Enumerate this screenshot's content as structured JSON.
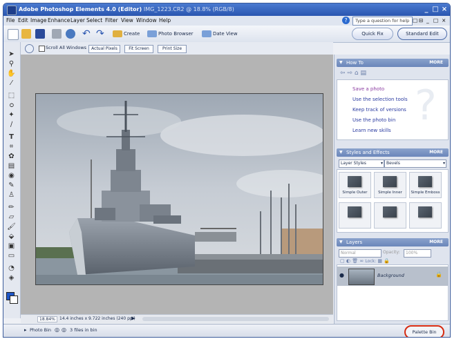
{
  "window": {
    "title": "Adobe Photoshop Elements 4.0 (Editor)",
    "document": "IMG_1223.CR2 @ 18.8% (RGB/8)",
    "controls": [
      "_",
      "□",
      "×"
    ]
  },
  "menu": {
    "items": [
      "File",
      "Edit",
      "Image",
      "Enhance",
      "Layer",
      "Select",
      "Filter",
      "View",
      "Window",
      "Help"
    ],
    "help_placeholder": "Type a question for help",
    "doc_controls": [
      "□",
      "⊟",
      "_",
      "□",
      "×"
    ]
  },
  "shortcuts": {
    "create": "Create",
    "photo_browser": "Photo Browser",
    "date_view": "Date View",
    "quick_fix": "Quick Fix",
    "standard_edit": "Standard Edit"
  },
  "options_bar": {
    "scroll_all": "Scroll All Windows",
    "actual_pixels": "Actual Pixels",
    "fit_screen": "Fit Screen",
    "print_size": "Print Size"
  },
  "status": {
    "zoom": "18.84%",
    "doc_size": "14.4 inches x 9.722 inches (240 ppi)"
  },
  "photo_bin": {
    "label": "Photo Bin",
    "count": "3 files in bin",
    "dock_label": "Palette Bin"
  },
  "how_to": {
    "title": "How To",
    "more": "MORE",
    "links": [
      "Save a photo",
      "Use the selection tools",
      "Keep track of versions",
      "Use the photo bin",
      "Learn new skills"
    ]
  },
  "styles": {
    "title": "Styles and Effects",
    "more": "MORE",
    "category": "Layer Styles",
    "library": "Bevels",
    "tiles": [
      "Simple Outer",
      "Simple Inner",
      "Simple Emboss",
      "",
      "",
      ""
    ]
  },
  "layers": {
    "title": "Layers",
    "more": "MORE",
    "blend_mode": "Normal",
    "opacity_label": "Opacity:",
    "opacity_value": "100%",
    "lock_label": "Lock:",
    "background_layer": "Background"
  },
  "colors": {
    "titlebar": "#2a56b0",
    "foreground": "#1e56c8",
    "background": "#ffffff",
    "link": "#2a3aa0",
    "sky": "#c6ccd4",
    "canvas_bg": "#b4b4b4"
  }
}
